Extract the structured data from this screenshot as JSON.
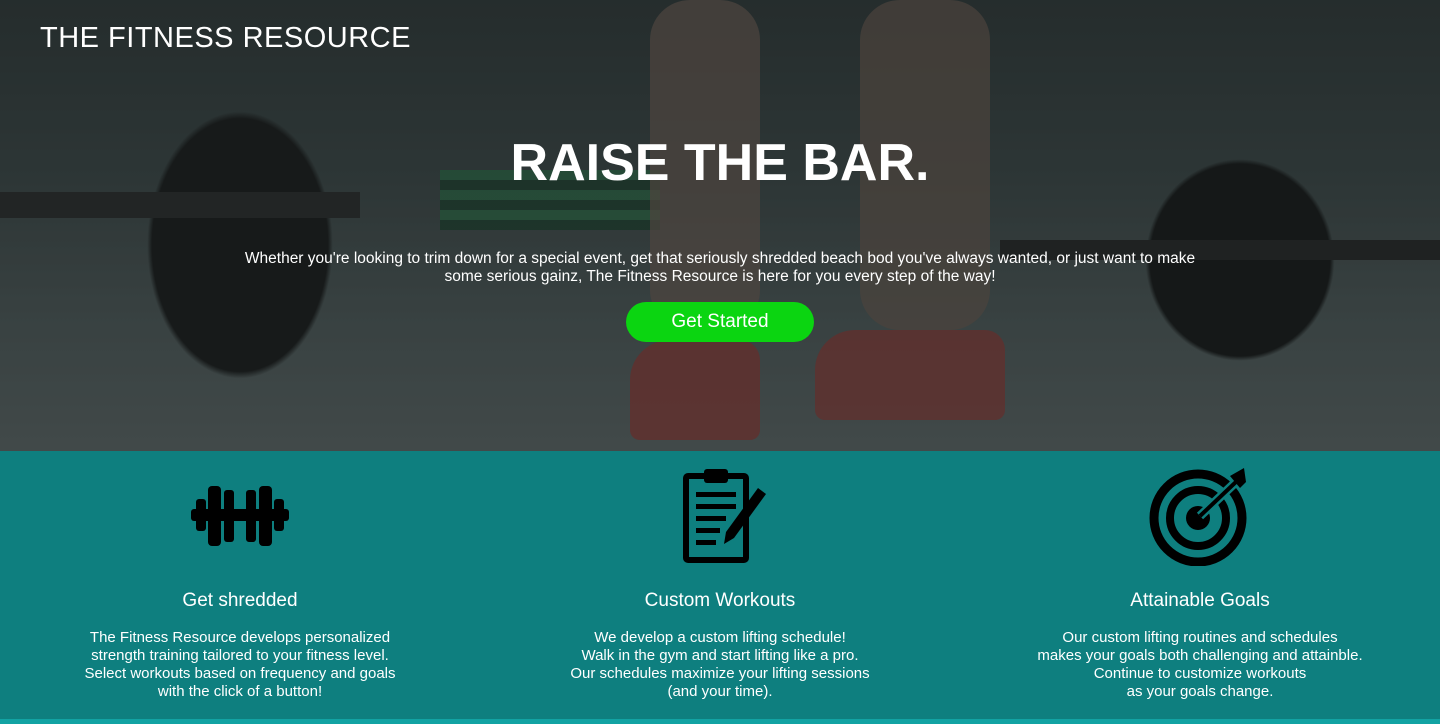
{
  "header": {
    "brand": "THE FITNESS RESOURCE"
  },
  "hero": {
    "headline": "RAISE THE BAR.",
    "lead_lines": [
      "Whether you're looking to trim down for a special event, get that seriously shredded beach bod you've always wanted, or just want to make",
      "some serious gainz, The Fitness Resource is here for you every step of the way!"
    ],
    "cta_label": "Get Started"
  },
  "features": [
    {
      "icon": "dumbbell-icon",
      "title": "Get shredded",
      "lines": [
        "The Fitness Resource develops personalized",
        "strength training tailored to your fitness level.",
        "Select workouts based on frequency and goals",
        "with the click of a button!"
      ]
    },
    {
      "icon": "clipboard-pen-icon",
      "title": "Custom Workouts",
      "lines": [
        "We develop a custom lifting schedule!",
        "Walk in the gym and start lifting like a pro.",
        "Our schedules maximize your lifting sessions",
        "(and your time)."
      ]
    },
    {
      "icon": "target-icon",
      "title": "Attainable Goals",
      "lines": [
        "Our custom lifting routines and schedules",
        "makes your goals both challenging and attainble.",
        "Continue to customize workouts",
        "as your goals change."
      ]
    }
  ],
  "colors": {
    "accent": "#0bd511",
    "teal": "#0e7f7f"
  }
}
